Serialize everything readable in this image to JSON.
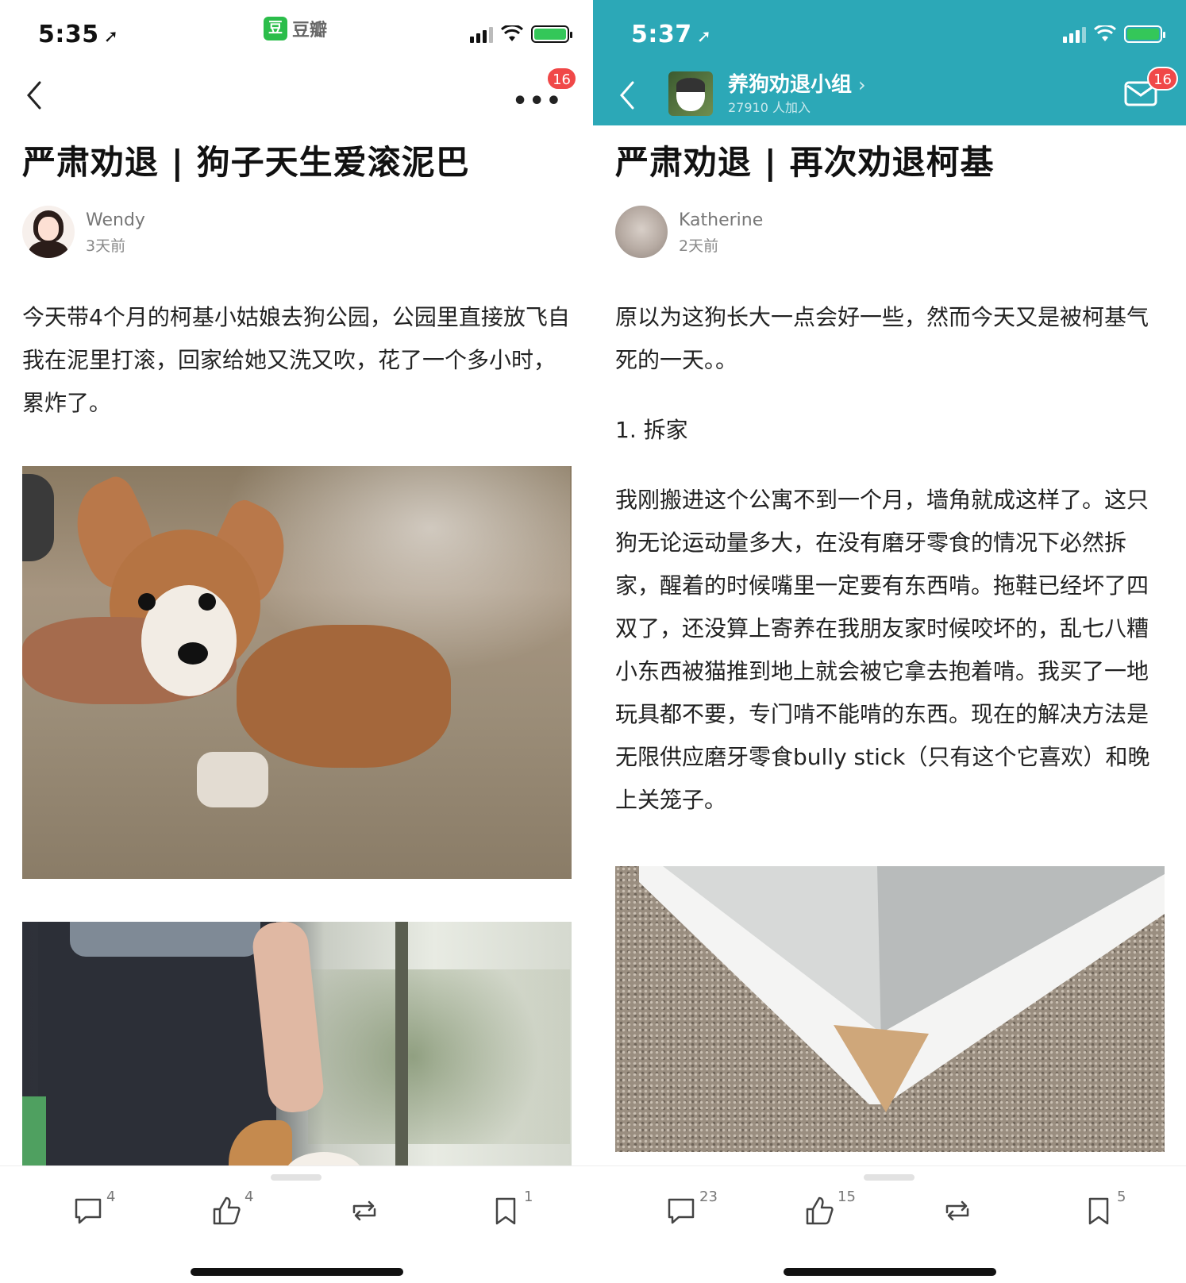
{
  "left": {
    "status": {
      "time": "5:35",
      "app_tag": "豆瓣",
      "app_logo": "豆"
    },
    "nav": {
      "badge": "16",
      "more": "•••"
    },
    "post": {
      "title": "严肃劝退 | 狗子天生爱滚泥巴",
      "author": "Wendy",
      "time_ago": "3天前",
      "body": "今天带4个月的柯基小姑娘去狗公园，公园里直接放飞自我在泥里打滚，回家给她又洗又吹，花了一个多小时，累炸了。"
    },
    "actions": {
      "comments": "4",
      "likes": "4",
      "reshare": "",
      "bookmarks": "1"
    }
  },
  "right": {
    "status": {
      "time": "5:37"
    },
    "nav": {
      "group_name": "养狗劝退小组",
      "group_chevron": "›",
      "group_members": "27910 人加入",
      "badge": "16"
    },
    "post": {
      "title": "严肃劝退 | 再次劝退柯基",
      "author": "Katherine",
      "time_ago": "2天前",
      "intro": "原以为这狗长大一点会好一些，然而今天又是被柯基气死的一天。。",
      "section": "1. 拆家",
      "body": "我刚搬进这个公寓不到一个月，墙角就成这样了。这只狗无论运动量多大，在没有磨牙零食的情况下必然拆家，醒着的时候嘴里一定要有东西啃。拖鞋已经坏了四双了，还没算上寄养在我朋友家时候咬坏的，乱七八糟小东西被猫推到地上就会被它拿去抱着啃。我买了一地玩具都不要，专门啃不能啃的东西。现在的解决方法是无限供应磨牙零食bully stick（只有这个它喜欢）和晚上关笼子。"
    },
    "actions": {
      "comments": "23",
      "likes": "15",
      "reshare": "",
      "bookmarks": "5"
    }
  },
  "colors": {
    "teal_header": "#2ca8b7",
    "badge_red": "#f04848",
    "douban_green": "#2bbd4a"
  },
  "icons": [
    "back-chevron-icon",
    "more-icon",
    "mail-icon",
    "comment-icon",
    "like-icon",
    "reshare-icon",
    "bookmark-icon",
    "location-arrow-icon",
    "signal-icon",
    "wifi-icon",
    "battery-icon"
  ]
}
